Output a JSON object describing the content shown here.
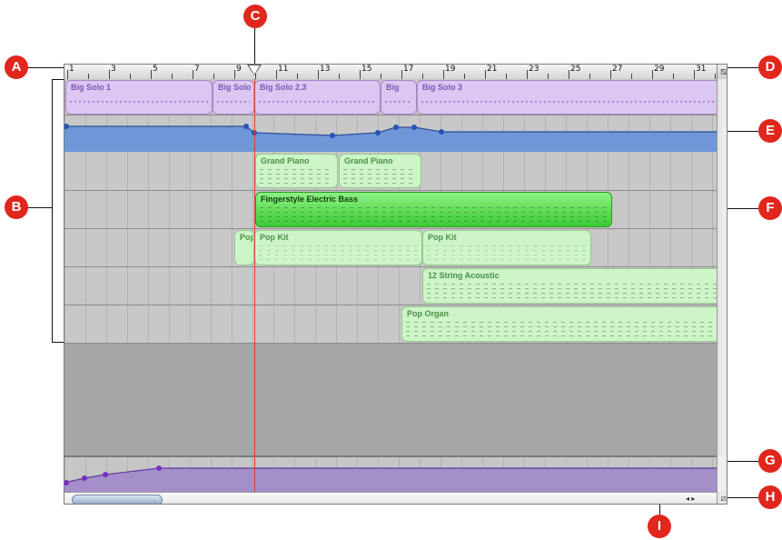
{
  "ruler": {
    "labels": [
      "1",
      "3",
      "5",
      "7",
      "9",
      "11",
      "13",
      "15",
      "17",
      "19",
      "21",
      "23",
      "25",
      "27",
      "29",
      "31"
    ]
  },
  "tracks": {
    "row1": [
      {
        "name": "Big Solo 1"
      },
      {
        "name": "Big Solo"
      },
      {
        "name": "Big Solo 2.3"
      },
      {
        "name": "Big"
      },
      {
        "name": "Big Solo 3"
      }
    ],
    "row3": [
      {
        "name": "Grand Piano"
      },
      {
        "name": "Grand Piano"
      }
    ],
    "row4": [
      {
        "name": "Fingerstyle Electric Bass"
      }
    ],
    "row5": [
      {
        "name": "Pop"
      },
      {
        "name": "Pop Kit"
      },
      {
        "name": "Pop Kit"
      }
    ],
    "row6": [
      {
        "name": "12 String Acoustic"
      }
    ],
    "row7": [
      {
        "name": "Pop Organ"
      }
    ]
  },
  "callouts": {
    "a": "A",
    "b": "B",
    "c": "C",
    "d": "D",
    "e": "E",
    "f": "F",
    "g": "G",
    "h": "H",
    "i": "I"
  },
  "colors": {
    "callout": "#e1261c",
    "playhead": "#e23b2a",
    "automation_blue": "#6f97d8",
    "master_purple": "#a58fcb"
  }
}
